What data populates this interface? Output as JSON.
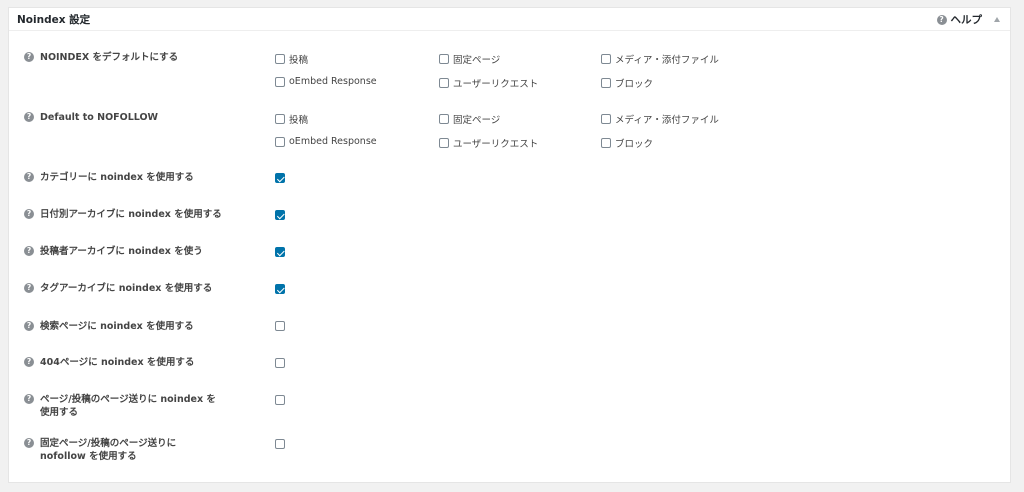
{
  "panel": {
    "title": "Noindex 設定",
    "help_label": "ヘルプ"
  },
  "post_types": [
    "投稿",
    "固定ページ",
    "メディア・添付ファイル",
    "oEmbed Response",
    "ユーザーリクエスト",
    "ブロック"
  ],
  "settings": {
    "noindex_default": {
      "label": "NOINDEX をデフォルトにする"
    },
    "nofollow_default": {
      "label": "Default to NOFOLLOW"
    },
    "category": {
      "label": "カテゴリーに noindex を使用する",
      "checked": true
    },
    "date_archive": {
      "label": "日付別アーカイブに noindex を使用する",
      "checked": true
    },
    "author_archive": {
      "label": "投稿者アーカイブに noindex を使う",
      "checked": true
    },
    "tag_archive": {
      "label": "タグアーカイブに noindex を使用する",
      "checked": true
    },
    "search_page": {
      "label": "検索ページに noindex を使用する",
      "checked": false
    },
    "page_404": {
      "label": "404ページに noindex を使用する",
      "checked": false
    },
    "paginated": {
      "label": "ページ/投稿のページ送りに noindex を使用する",
      "checked": false
    },
    "paginated_nofollow": {
      "label": "固定ページ/投稿のページ送りに nofollow を使用する",
      "checked": false
    }
  },
  "icons": {
    "help": "question-mark-circle-icon",
    "toggle": "triangle-up-icon"
  },
  "colors": {
    "checked": "#0073aa",
    "help_icon": "#8a8f94"
  }
}
